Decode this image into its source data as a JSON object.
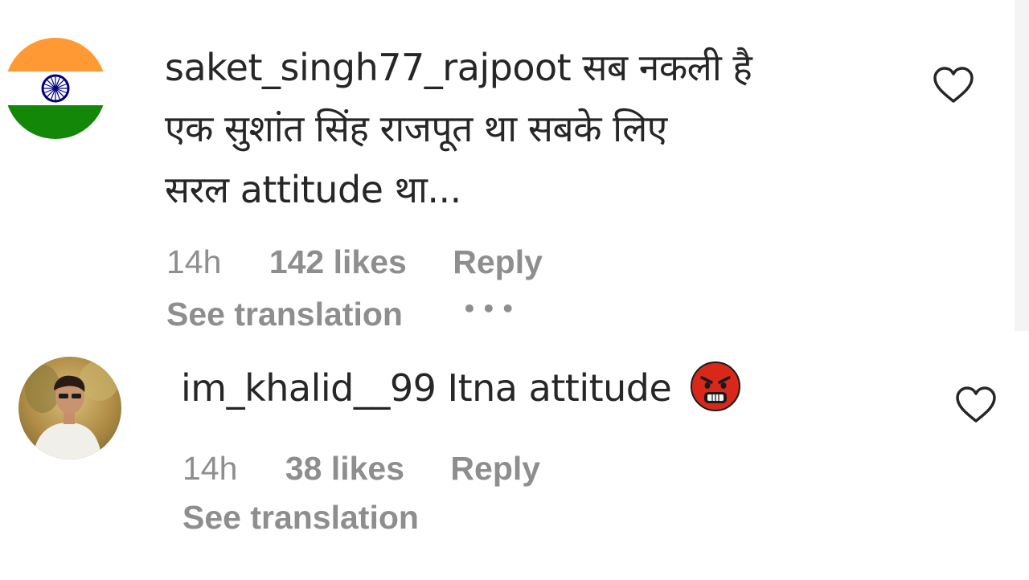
{
  "comments": [
    {
      "username": "saket_singh77_rajpoot",
      "text_line1": "सब नकली है",
      "text_line2": "एक सुशांत सिंह राजपूत था सबके लिए",
      "text_line3": "सरल attitude था...",
      "time": "14h",
      "likes": "142 likes",
      "reply": "Reply",
      "see_translation": "See translation",
      "more": "•••",
      "avatar_icon": "india-flag-avatar",
      "like_icon": "heart-outline-icon"
    },
    {
      "username": "im_khalid__99",
      "text": "Itna attitude",
      "emoji": "angry-face-emoji",
      "time": "14h",
      "likes": "38 likes",
      "reply": "Reply",
      "see_translation": "See translation",
      "avatar_icon": "user-photo-avatar",
      "like_icon": "heart-outline-icon"
    }
  ],
  "colors": {
    "text": "#262626",
    "secondary": "#8e8e8e",
    "flag_saffron": "#ff9933",
    "flag_green": "#138808",
    "flag_chakra": "#000080"
  }
}
